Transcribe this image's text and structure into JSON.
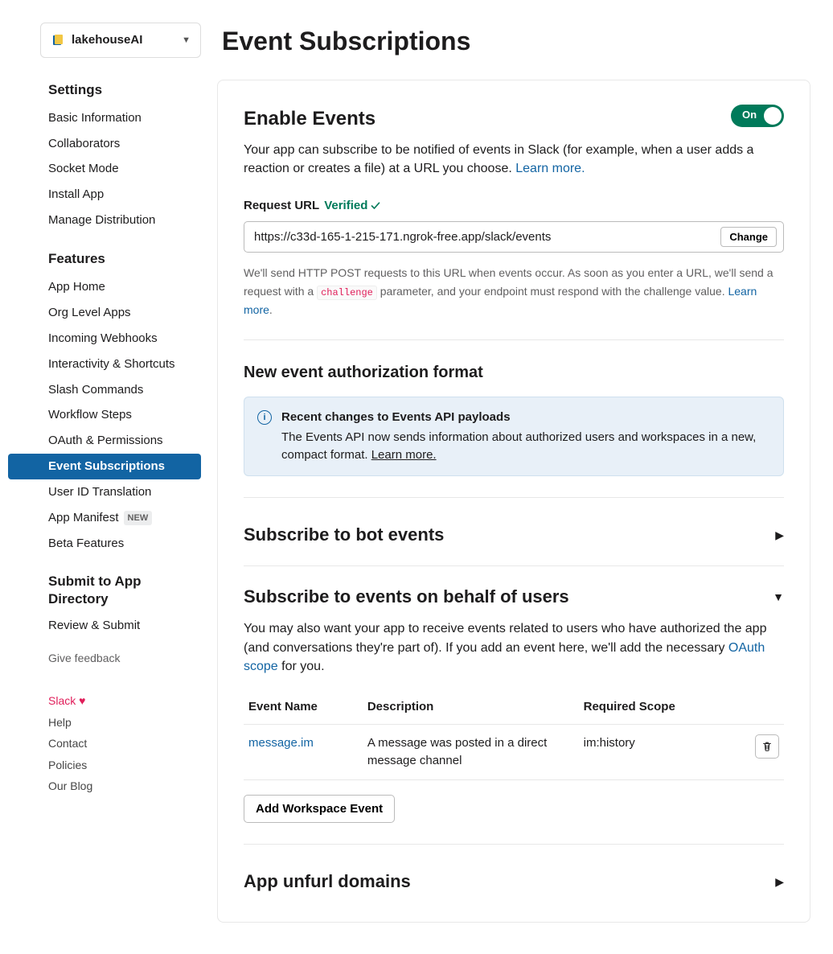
{
  "app_selector": {
    "name": "lakehouseAI"
  },
  "sidebar": {
    "settings_heading": "Settings",
    "settings_items": [
      "Basic Information",
      "Collaborators",
      "Socket Mode",
      "Install App",
      "Manage Distribution"
    ],
    "features_heading": "Features",
    "features_items": [
      {
        "label": "App Home"
      },
      {
        "label": "Org Level Apps"
      },
      {
        "label": "Incoming Webhooks"
      },
      {
        "label": "Interactivity & Shortcuts"
      },
      {
        "label": "Slash Commands"
      },
      {
        "label": "Workflow Steps"
      },
      {
        "label": "OAuth & Permissions"
      },
      {
        "label": "Event Subscriptions",
        "active": true
      },
      {
        "label": "User ID Translation"
      },
      {
        "label": "App Manifest",
        "badge": "NEW"
      },
      {
        "label": "Beta Features"
      }
    ],
    "submit_heading": "Submit to App Directory",
    "submit_items": [
      "Review & Submit"
    ],
    "feedback": "Give feedback",
    "footer": {
      "slack": "Slack",
      "help": "Help",
      "contact": "Contact",
      "policies": "Policies",
      "blog": "Our Blog"
    }
  },
  "page_title": "Event Subscriptions",
  "enable": {
    "heading": "Enable Events",
    "toggle_label": "On",
    "description": "Your app can subscribe to be notified of events in Slack (for example, when a user adds a reaction or creates a file) at a URL you choose.",
    "learn_more": "Learn more."
  },
  "request_url": {
    "label": "Request URL",
    "verified": "Verified",
    "value": "https://c33d-165-1-215-171.ngrok-free.app/slack/events",
    "change": "Change",
    "helper_a": "We'll send HTTP POST requests to this URL when events occur. As soon as you enter a URL, we'll send a request with a ",
    "helper_code": "challenge",
    "helper_b": " parameter, and your endpoint must respond with the challenge value. ",
    "helper_learn": "Learn more"
  },
  "auth_format": {
    "heading": "New event authorization format",
    "info_title": "Recent changes to Events API payloads",
    "info_body": "The Events API now sends information about authorized users and workspaces in a new, compact format.",
    "info_learn": "Learn more."
  },
  "bot_events": {
    "heading": "Subscribe to bot events"
  },
  "user_events": {
    "heading": "Subscribe to events on behalf of users",
    "desc_a": "You may also want your app to receive events related to users who have authorized the app (and conversations they're part of). If you add an event here, we'll add the necessary ",
    "oauth_link": "OAuth scope",
    "desc_b": " for you.",
    "columns": {
      "event": "Event Name",
      "desc": "Description",
      "scope": "Required Scope"
    },
    "rows": [
      {
        "event": "message.im",
        "desc": "A message was posted in a direct message channel",
        "scope": "im:history"
      }
    ],
    "add_button": "Add Workspace Event"
  },
  "unfurl": {
    "heading": "App unfurl domains"
  }
}
